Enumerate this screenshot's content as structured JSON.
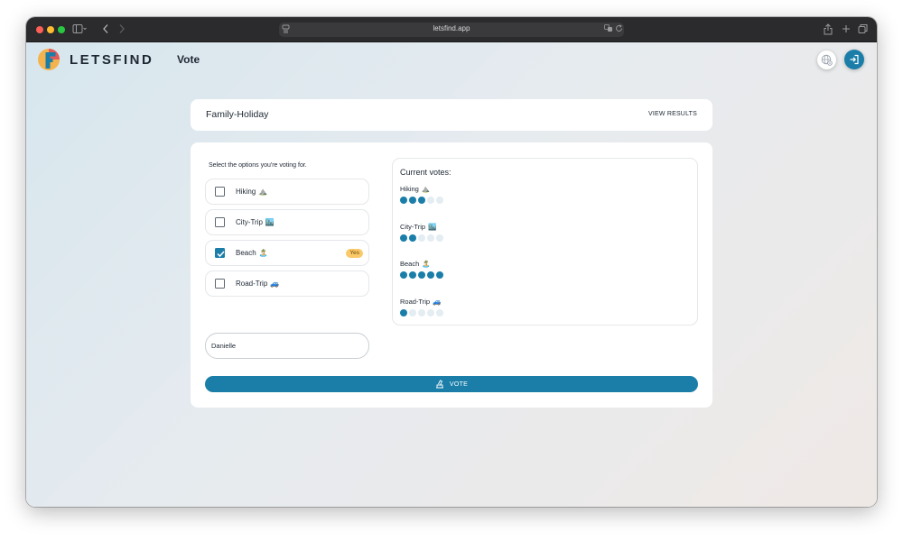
{
  "browser": {
    "url": "letsfind.app"
  },
  "app": {
    "brand": "LETSFIND",
    "page_title": "Vote"
  },
  "poll": {
    "title": "Family-Holiday",
    "view_results_label": "VIEW RESULTS",
    "instruction": "Select the options you're voting for.",
    "options": [
      {
        "label": "Hiking",
        "emoji": "⛰️",
        "checked": false
      },
      {
        "label": "City-Trip",
        "emoji": "🏙️",
        "checked": false
      },
      {
        "label": "Beach",
        "emoji": "🏝️",
        "checked": true,
        "badge": "Yes"
      },
      {
        "label": "Road-Trip",
        "emoji": "🚙",
        "checked": false
      }
    ],
    "name_value": "Danielle",
    "vote_button_label": "VOTE"
  },
  "votes": {
    "heading": "Current votes:",
    "max": 5,
    "items": [
      {
        "label": "Hiking",
        "emoji": "⛰️",
        "count": 3
      },
      {
        "label": "City-Trip",
        "emoji": "🏙️",
        "count": 2
      },
      {
        "label": "Beach",
        "emoji": "🏝️",
        "count": 5
      },
      {
        "label": "Road-Trip",
        "emoji": "🚙",
        "count": 1
      }
    ]
  },
  "colors": {
    "accent": "#1a7ea8",
    "badge": "#fbc96a",
    "dot_empty": "#e3edf2"
  },
  "icons": {
    "lang": "globe-icon",
    "login": "login-icon",
    "vote": "ballot-icon"
  }
}
